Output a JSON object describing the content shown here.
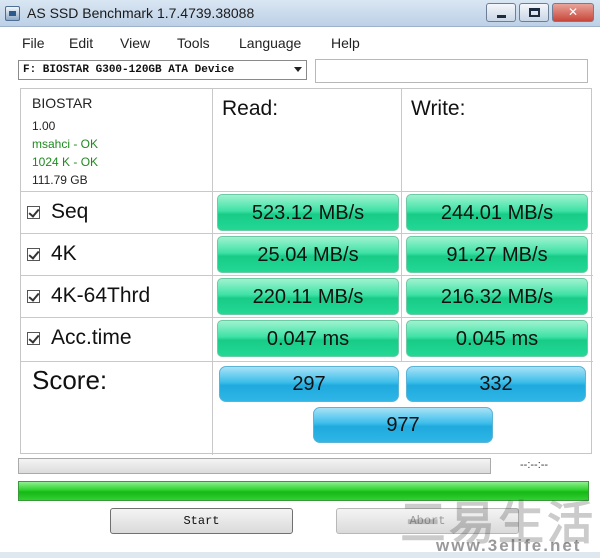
{
  "window": {
    "title": "AS SSD Benchmark 1.7.4739.38088",
    "min_glyph": "",
    "max_glyph": "",
    "close_glyph": "✕"
  },
  "menu": {
    "items": [
      "File",
      "Edit",
      "View",
      "Tools",
      "Language",
      "Help"
    ]
  },
  "device": {
    "selected": "F: BIOSTAR G300-120GB ATA Device",
    "extra_field_value": ""
  },
  "drive_info": {
    "name": "BIOSTAR",
    "firmware": "1.00",
    "msahci": "msahci - OK",
    "alignment": "1024 K - OK",
    "size": "111.79 GB"
  },
  "columns": {
    "read": "Read:",
    "write": "Write:"
  },
  "tests": [
    {
      "label": "Seq",
      "checked": true,
      "read": "523.12 MB/s",
      "write": "244.01 MB/s"
    },
    {
      "label": "4K",
      "checked": true,
      "read": "25.04 MB/s",
      "write": "91.27 MB/s"
    },
    {
      "label": "4K-64Thrd",
      "checked": true,
      "read": "220.11 MB/s",
      "write": "216.32 MB/s"
    },
    {
      "label": "Acc.time",
      "checked": true,
      "read": "0.047 ms",
      "write": "0.045 ms"
    }
  ],
  "score": {
    "label": "Score:",
    "read": "297",
    "write": "332",
    "total": "977"
  },
  "progress": {
    "current_fraction": 1.0,
    "total_fraction": 1.0,
    "time": "--:--:--"
  },
  "buttons": {
    "start": "Start",
    "abort": "Abort"
  },
  "watermark": {
    "chars": "三易生活",
    "url": "www.3elife.net"
  },
  "colors": {
    "result_green": "#22d894",
    "score_blue": "#1fa9dd",
    "progress_green": "#2dd12d",
    "ok_text": "#1f8a1f"
  }
}
